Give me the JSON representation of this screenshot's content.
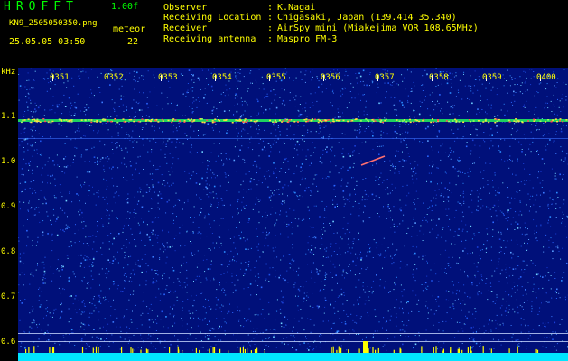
{
  "header": {
    "app_title": "HROFFT",
    "version": "1.00f",
    "filename": "KN9_2505050350.png",
    "datetime": "25.05.05 03:50",
    "meteor_label": "meteor",
    "meteor_count": "22"
  },
  "info": {
    "observer_label": "Observer",
    "observer_value": "K.Nagai",
    "location_label": "Receiving Location",
    "location_value": "Chigasaki, Japan (139.414 35.340)",
    "receiver_label": "Receiver",
    "receiver_value": "AirSpy mini (Miakejima VOR 108.65MHz)",
    "antenna_label": "Receiving antenna",
    "antenna_value": "Maspro FM-3",
    "separator": ":"
  },
  "axis": {
    "unit": "kHz",
    "y_labels": [
      "1.1",
      "1.0",
      "0.9",
      "0.8",
      "0.7",
      "0.6"
    ],
    "x_labels": [
      "0351",
      "0352",
      "0353",
      "0354",
      "0355",
      "0356",
      "0357",
      "0358",
      "0359",
      "0400"
    ]
  },
  "colors": {
    "background": "#000000",
    "spectrum_bg": "#00107a",
    "label_green": "#00ff00",
    "label_yellow": "#ffff00",
    "carrier": "#2ecc4a",
    "baseline": "#00ffff"
  }
}
